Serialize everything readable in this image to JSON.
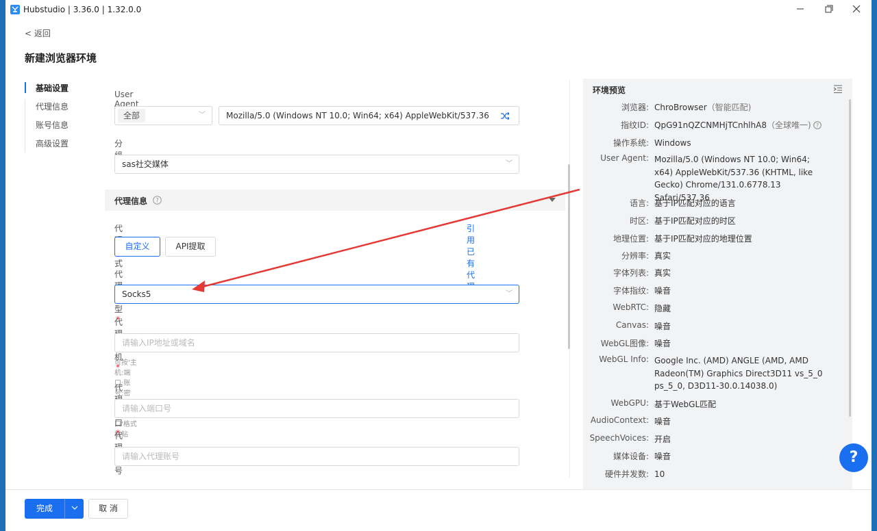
{
  "window": {
    "title": "Hubstudio | 3.36.0 | 1.32.0.0"
  },
  "header": {
    "back": "< 返回",
    "title": "新建浏览器环境"
  },
  "nav": {
    "items": [
      "基础设置",
      "代理信息",
      "账号信息",
      "高级设置"
    ],
    "active": "基础设置"
  },
  "form": {
    "ua_label": "User Agent",
    "ua_filter": "全部",
    "ua_value": "Mozilla/5.0 (Windows NT 10.0; Win64; x64) AppleWebKit/537.36 (KHT",
    "group_label": "分组",
    "group_value": "sas社交媒体",
    "proxy_section": "代理信息",
    "proxy_mode_label": "代理方式",
    "use_existing_proxy": "引用已有代理",
    "mode_custom": "自定义",
    "mode_api": "API提取",
    "proxy_type_label": "代理类型",
    "proxy_type_value": "Socks5",
    "proxy_host_label": "代理主机",
    "proxy_host_placeholder": "请输入IP地址或域名",
    "proxy_host_hint": "可按'主机:端口:账号:密码'或'主机:端口'格式粘贴",
    "proxy_port_label": "代理端口",
    "proxy_port_placeholder": "请输入端口号",
    "proxy_account_label": "代理账号",
    "proxy_account_placeholder": "请输入代理账号",
    "required_mark": "*"
  },
  "preview": {
    "title": "环境预览",
    "rows": [
      {
        "key": "浏览器:",
        "value": "ChroBrowser",
        "note": "（智能匹配)"
      },
      {
        "key": "指纹ID:",
        "value": "QpG91nQZCNMHjTCnhlhA8",
        "note": "（全球唯一)"
      },
      {
        "key": "操作系统:",
        "value": "Windows"
      },
      {
        "key": "User Agent:",
        "value": "Mozilla/5.0 (Windows NT 10.0; Win64; x64) AppleWebKit/537.36 (KHTML, like Gecko) Chrome/131.0.6778.13 Safari/537.36"
      },
      {
        "key": "语言:",
        "value": "基于IP匹配对应的语言"
      },
      {
        "key": "时区:",
        "value": "基于IP匹配对应的时区"
      },
      {
        "key": "地理位置:",
        "value": "基于IP匹配对应的地理位置"
      },
      {
        "key": "分辨率:",
        "value": "真实"
      },
      {
        "key": "字体列表:",
        "value": "真实"
      },
      {
        "key": "字体指纹:",
        "value": "噪音"
      },
      {
        "key": "WebRTC:",
        "value": "隐藏"
      },
      {
        "key": "Canvas:",
        "value": "噪音"
      },
      {
        "key": "WebGL图像:",
        "value": "噪音"
      },
      {
        "key": "WebGL Info:",
        "value": "Google Inc. (AMD) ANGLE (AMD, AMD Radeon(TM) Graphics Direct3D11 vs_5_0 ps_5_0, D3D11-30.0.14038.0)"
      },
      {
        "key": "WebGPU:",
        "value": "基于WebGL匹配"
      },
      {
        "key": "AudioContext:",
        "value": "噪音"
      },
      {
        "key": "SpeechVoices:",
        "value": "开启"
      },
      {
        "key": "媒体设备:",
        "value": "噪音"
      },
      {
        "key": "硬件并发数:",
        "value": "10"
      }
    ]
  },
  "footer": {
    "done": "完成",
    "cancel": "取 消"
  },
  "help": "?",
  "colors": {
    "accent": "#1a6ef0",
    "danger": "#f5222d",
    "annotation_arrow": "#e53935"
  }
}
